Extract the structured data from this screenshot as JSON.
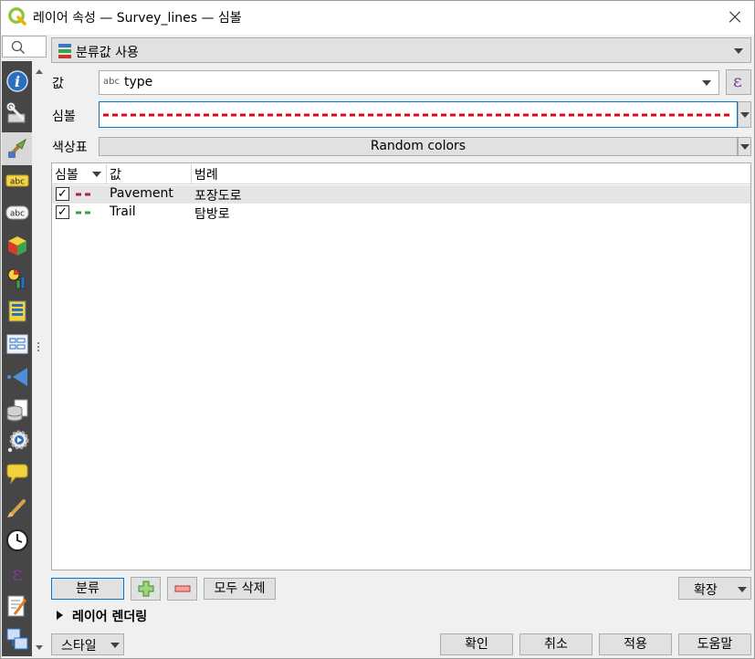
{
  "window": {
    "title": "레이어 속성 — Survey_lines — 심볼"
  },
  "sidebar": {
    "search_placeholder": "",
    "items": [
      {
        "name": "information",
        "icon": "info-icon"
      },
      {
        "name": "source",
        "icon": "source-wrench-icon"
      },
      {
        "name": "symbology",
        "icon": "symbology-brush-icon"
      },
      {
        "name": "labels",
        "icon": "labels-abc-icon"
      },
      {
        "name": "masks",
        "icon": "masks-abc-icon"
      },
      {
        "name": "3d-view",
        "icon": "cube-3d-icon"
      },
      {
        "name": "diagrams",
        "icon": "diagram-icon"
      },
      {
        "name": "fields",
        "icon": "fields-table-icon"
      },
      {
        "name": "attributes-form",
        "icon": "form-icon"
      },
      {
        "name": "joins",
        "icon": "joins-icon"
      },
      {
        "name": "auxiliary-storage",
        "icon": "database-icon"
      },
      {
        "name": "actions",
        "icon": "actions-gear-icon"
      },
      {
        "name": "display",
        "icon": "speech-bubble-icon"
      },
      {
        "name": "rendering",
        "icon": "paintbrush-icon"
      },
      {
        "name": "temporal",
        "icon": "clock-icon"
      },
      {
        "name": "variables",
        "icon": "epsilon-icon"
      },
      {
        "name": "metadata",
        "icon": "metadata-pencil-icon"
      },
      {
        "name": "dependencies",
        "icon": "dependencies-icon"
      }
    ]
  },
  "renderer": {
    "selected": "분류값 사용"
  },
  "form": {
    "value_label": "값",
    "value_type_hint": "abc",
    "value_field": "type",
    "symbol_label": "심볼",
    "colorramp_label": "색상표",
    "colorramp_value": "Random colors"
  },
  "table": {
    "headers": [
      "심볼",
      "값",
      "범례"
    ],
    "rows": [
      {
        "checked": true,
        "color": "#b22243",
        "value": "Pavement",
        "legend": "포장도로"
      },
      {
        "checked": true,
        "color": "#3a9c3a",
        "value": "Trail",
        "legend": "탐방로"
      }
    ]
  },
  "buttons": {
    "classify": "분류",
    "delete_all": "모두 삭제",
    "advanced": "확장",
    "style": "스타일",
    "ok": "확인",
    "cancel": "취소",
    "apply": "적용",
    "help": "도움말"
  },
  "section": {
    "layer_rendering": "레이어 렌더링"
  },
  "colors": {
    "symbol_line": "#e8001c",
    "sidebar_bg": "#464646",
    "qgis_green": "#8cc63f"
  }
}
